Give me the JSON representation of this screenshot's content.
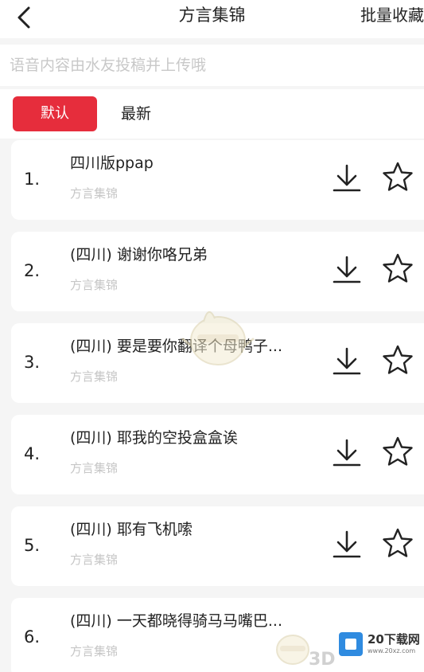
{
  "header": {
    "title": "方言集锦",
    "batch_favorite": "批量收藏"
  },
  "notice": {
    "text": "语音内容由水友投稿并上传哦"
  },
  "filters": {
    "default": "默认",
    "latest": "最新",
    "active_color": "#e62d3c"
  },
  "items": [
    {
      "index": "1.",
      "title": "四川版ppap",
      "subtitle": "方言集锦"
    },
    {
      "index": "2.",
      "title": "(四川) 谢谢你咯兄弟",
      "subtitle": "方言集锦"
    },
    {
      "index": "3.",
      "title": "(四川) 要是要你翻译个母鸭子...",
      "subtitle": "方言集锦"
    },
    {
      "index": "4.",
      "title": "(四川) 耶我的空投盒盒诶",
      "subtitle": "方言集锦"
    },
    {
      "index": "5.",
      "title": "(四川) 耶有飞机嗦",
      "subtitle": "方言集锦"
    },
    {
      "index": "6.",
      "title": "(四川) 一天都晓得骑马马嘴巴...",
      "subtitle": "方言集锦"
    }
  ],
  "watermark": {
    "brand": "20下载网",
    "url": "www.20xz.com",
    "mark": "3D"
  },
  "icons": {
    "back": "chevron-left-icon",
    "download": "download-icon",
    "favorite": "star-outline-icon"
  }
}
